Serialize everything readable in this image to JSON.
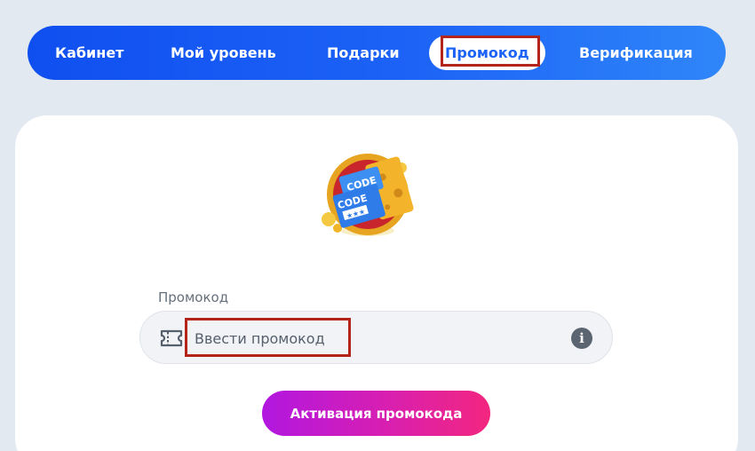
{
  "nav": {
    "items": [
      {
        "label": "Кабинет"
      },
      {
        "label": "Мой уровень"
      },
      {
        "label": "Подарки"
      },
      {
        "label": "Промокод",
        "active": true
      },
      {
        "label": "Верификация"
      }
    ]
  },
  "badge": {
    "codes": [
      "CODE",
      "CODE"
    ],
    "stars": "★★★"
  },
  "promo": {
    "label": "Промокод",
    "placeholder": "Ввести промокод",
    "value": "",
    "button_label": "Активация промокода"
  },
  "colors": {
    "nav_gradient_start": "#0f4ff0",
    "nav_gradient_end": "#2f86f9",
    "button_gradient_start": "#b117e0",
    "button_gradient_end": "#f3267f",
    "highlight": "#b3251a",
    "page_background": "#e3e9f1"
  },
  "icons": [
    "ticket-icon",
    "info-icon",
    "promo-code-badge-icon"
  ]
}
